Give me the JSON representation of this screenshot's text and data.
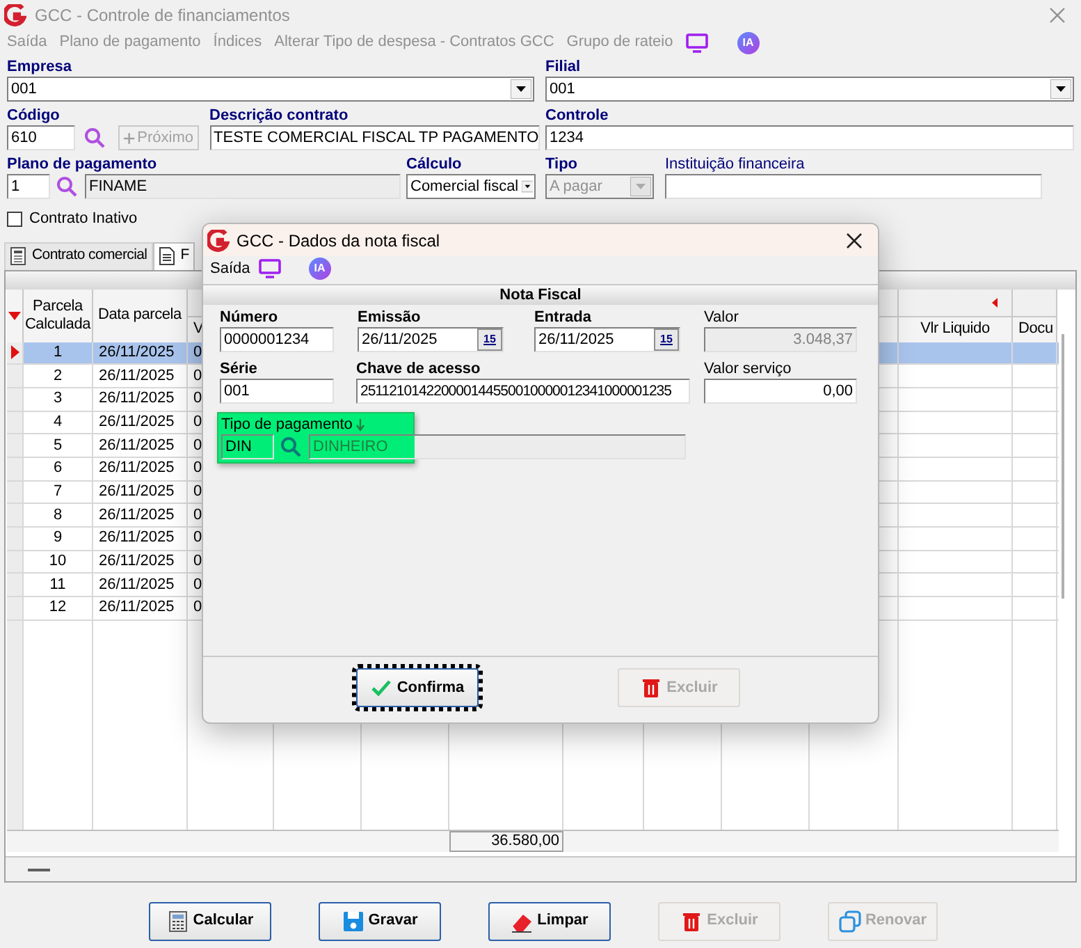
{
  "window": {
    "title": "GCC - Controle de financiamentos"
  },
  "menu": [
    {
      "label": "Saída",
      "disabled": true
    },
    {
      "label": "Plano de pagamento",
      "disabled": true
    },
    {
      "label": "Índices",
      "disabled": true
    },
    {
      "label": "Alterar Tipo de despesa - Contratos GCC",
      "disabled": true
    },
    {
      "label": "Grupo de rateio",
      "disabled": true
    }
  ],
  "menu_badge": "IA",
  "form": {
    "empresa": {
      "label": "Empresa",
      "value": "001"
    },
    "filial": {
      "label": "Filial",
      "value": "001"
    },
    "codigo": {
      "label": "Código",
      "value": "610"
    },
    "proximo": {
      "label": "Próximo",
      "disabled": true
    },
    "descricao": {
      "label": "Descrição contrato",
      "value": "TESTE COMERCIAL FISCAL TP PAGAMENTO"
    },
    "controle": {
      "label": "Controle",
      "value": "1234"
    },
    "plano": {
      "label": "Plano de pagamento",
      "code": "1",
      "name": "FINAME"
    },
    "calculo": {
      "label": "Cálculo",
      "value": "Comercial fiscal"
    },
    "tipo": {
      "label": "Tipo",
      "value": "A pagar",
      "disabled": true
    },
    "instituicao": {
      "label": "Instituição financeira"
    },
    "inativo": {
      "label": "Contrato Inativo",
      "checked": false
    }
  },
  "tabs": [
    {
      "label": "Contrato comercial",
      "selected": false
    },
    {
      "label": "F",
      "selected": true
    }
  ],
  "grid": {
    "columns": [
      {
        "label": "Parcela Calculada"
      },
      {
        "label": "Data parcela"
      },
      {
        "label": "V"
      },
      {
        "label": "Vlr Liquido"
      },
      {
        "label": "Docu"
      }
    ],
    "rows": [
      {
        "cells": [
          "1",
          "26/11/2025",
          "0"
        ],
        "selected": true
      },
      {
        "cells": [
          "2",
          "26/11/2025",
          "0"
        ],
        "selected": false
      },
      {
        "cells": [
          "3",
          "26/11/2025",
          "0"
        ],
        "selected": false
      },
      {
        "cells": [
          "4",
          "26/11/2025",
          "0"
        ],
        "selected": false
      },
      {
        "cells": [
          "5",
          "26/11/2025",
          "0"
        ],
        "selected": false
      },
      {
        "cells": [
          "6",
          "26/11/2025",
          "0"
        ],
        "selected": false
      },
      {
        "cells": [
          "7",
          "26/11/2025",
          "0"
        ],
        "selected": false
      },
      {
        "cells": [
          "8",
          "26/11/2025",
          "0"
        ],
        "selected": false
      },
      {
        "cells": [
          "9",
          "26/11/2025",
          "0"
        ],
        "selected": false
      },
      {
        "cells": [
          "10",
          "26/11/2025",
          "0"
        ],
        "selected": false
      },
      {
        "cells": [
          "11",
          "26/11/2025",
          "0"
        ],
        "selected": false
      },
      {
        "cells": [
          "12",
          "26/11/2025",
          "0"
        ],
        "selected": false
      }
    ],
    "total": "36.580,00"
  },
  "buttons": [
    {
      "kind": "calc",
      "label": "Calcular",
      "disabled": false
    },
    {
      "kind": "save",
      "label": "Gravar",
      "disabled": false
    },
    {
      "kind": "eraser",
      "label": "Limpar",
      "disabled": false
    },
    {
      "kind": "trash",
      "label": "Excluir",
      "disabled": true
    },
    {
      "kind": "copy",
      "label": "Renovar",
      "disabled": true
    }
  ],
  "dialog": {
    "title": "GCC - Dados da nota fiscal",
    "menu": [
      {
        "label": "Saída",
        "disabled": false
      }
    ],
    "menu_badge": "IA",
    "section": "Nota Fiscal",
    "numero": {
      "label": "Número",
      "value": "0000001234"
    },
    "emissao": {
      "label": "Emissão",
      "value": "26/11/2025",
      "calendar": "15"
    },
    "entrada": {
      "label": "Entrada",
      "value": "26/11/2025",
      "calendar": "15"
    },
    "valor": {
      "label": "Valor",
      "value": "3.048,37",
      "disabled": true
    },
    "serie": {
      "label": "Série",
      "value": "001"
    },
    "chave": {
      "label": "Chave de acesso",
      "value": "251121014220000144550010000012341000001235"
    },
    "valor_servico": {
      "label": "Valor serviço",
      "value": "0,00"
    },
    "tipo_pagamento": {
      "label": "Tipo de pagamento",
      "code": "DIN",
      "name": "DINHEIRO"
    },
    "buttons": [
      {
        "kind": "check",
        "label": "Confirma",
        "disabled": false
      },
      {
        "kind": "trash",
        "label": "Excluir",
        "disabled": true
      }
    ]
  }
}
